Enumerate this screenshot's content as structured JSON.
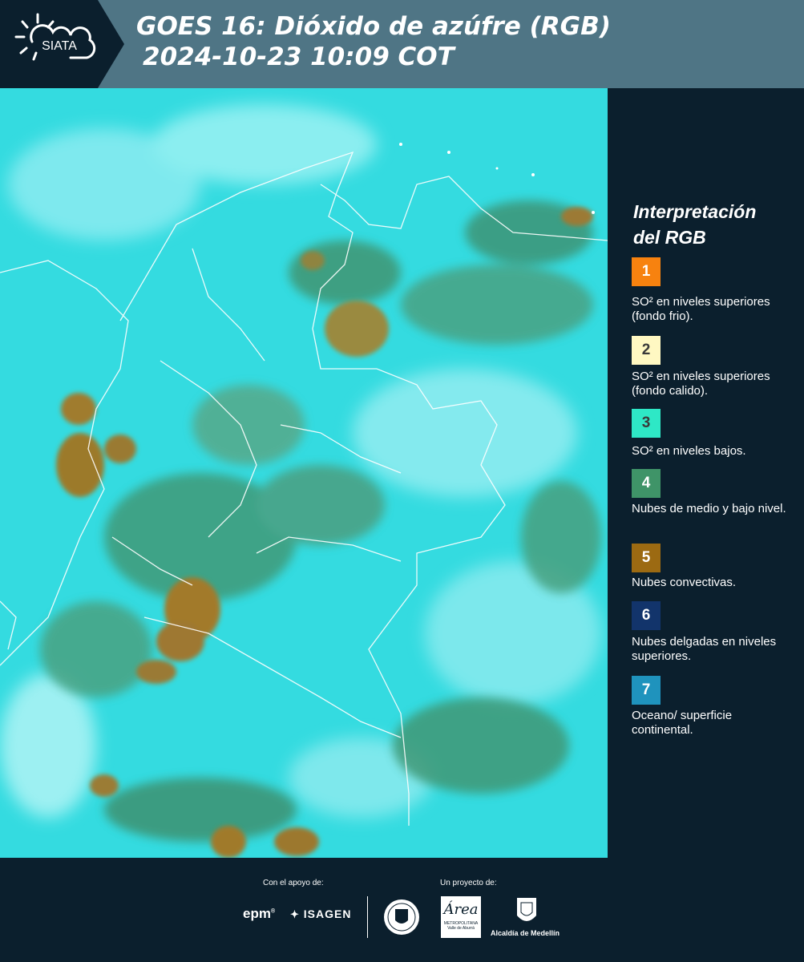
{
  "header": {
    "logo_text": "SIATA",
    "title_line1": "GOES 16: Dióxido de azúfre (RGB)",
    "title_line2": "2024-10-23 10:09 COT"
  },
  "legend": {
    "title_line1": "Interpretación",
    "title_line2": "del RGB",
    "items": [
      {
        "number": "1",
        "color": "#f7820f",
        "num_color": "#ffffff",
        "desc": "SO² en niveles superiores (fondo frio)."
      },
      {
        "number": "2",
        "color": "#fff8c2",
        "num_color": "#3a3a3a",
        "desc": "SO² en niveles superiores (fondo calido)."
      },
      {
        "number": "3",
        "color": "#2ee8c6",
        "num_color": "#3a3a3a",
        "desc": "SO² en niveles bajos."
      },
      {
        "number": "4",
        "color": "#3f9468",
        "num_color": "#ffffff",
        "desc": "Nubes de medio y bajo nivel."
      },
      {
        "number": "5",
        "color": "#9c6a12",
        "num_color": "#ffffff",
        "desc": "Nubes convectivas."
      },
      {
        "number": "6",
        "color": "#12346b",
        "num_color": "#ffffff",
        "desc": "Nubes delgadas en niveles superiores."
      },
      {
        "number": "7",
        "color": "#1f93bd",
        "num_color": "#ffffff",
        "desc": "Oceano/ superficie continental."
      }
    ]
  },
  "footer": {
    "support_label": "Con el apoyo de:",
    "project_label": "Un proyecto de:",
    "sponsor_epm": "epm",
    "sponsor_isagen": "ISAGEN",
    "partner_area_line1": "METROPOLITANA",
    "partner_area_line2": "Valle de Aburrá",
    "partner_medellin": "Alcaldía de Medellín"
  }
}
